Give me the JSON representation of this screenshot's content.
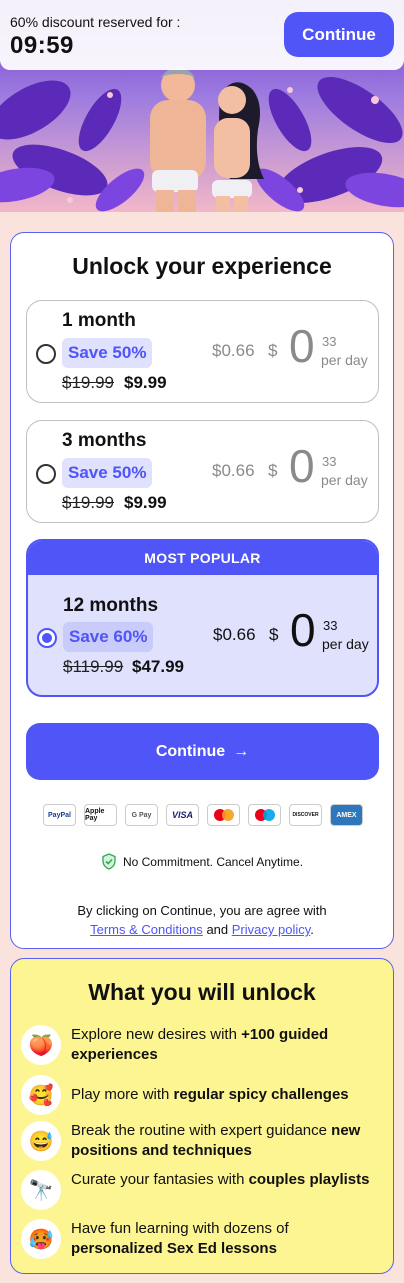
{
  "header": {
    "discount_text": "60% discount reserved for :",
    "timer": "09:59",
    "continue_label": "Continue"
  },
  "plans": {
    "title": "Unlock your experience",
    "options": [
      {
        "name": "1 month",
        "save": "Save 50%",
        "old_price": "$19.99",
        "new_price": "$9.99",
        "per_day_price": "$0.66",
        "currency": "$",
        "big_zero": "0",
        "cents": "33",
        "per_day": "per day",
        "selected": false
      },
      {
        "name": "3 months",
        "save": "Save 50%",
        "old_price": "$19.99",
        "new_price": "$9.99",
        "per_day_price": "$0.66",
        "currency": "$",
        "big_zero": "0",
        "cents": "33",
        "per_day": "per day",
        "selected": false
      },
      {
        "banner": "MOST POPULAR",
        "name": "12 months",
        "save": "Save 60%",
        "old_price": "$119.99",
        "new_price": "$47.99",
        "per_day_price": "$0.66",
        "currency": "$",
        "big_zero": "0",
        "cents": "33",
        "per_day": "per day",
        "selected": true
      }
    ],
    "continue_label": "Continue",
    "continue_arrow": "→",
    "payment_methods": [
      "PayPal",
      "Apple Pay",
      "G Pay",
      "VISA",
      "Mastercard",
      "Maestro",
      "DISCOVER",
      "AMEX"
    ],
    "commitment": "No Commitment. Cancel Anytime.",
    "terms_prefix": "By clicking on Continue, you are agree with",
    "terms_link": "Terms & Conditions",
    "terms_and": "and",
    "privacy_link": "Privacy policy",
    "terms_end": "."
  },
  "unlock": {
    "title": "What you will unlock",
    "features": [
      {
        "icon": "peach-icon",
        "glyph": "🍑",
        "text": "Explore new desires with ",
        "bold": "+100 guided experiences"
      },
      {
        "icon": "smiling-face-hearts-icon",
        "glyph": "🥰",
        "text": "Play more with ",
        "bold": "regular spicy challenges"
      },
      {
        "icon": "sweat-smile-icon",
        "glyph": "😅",
        "text": "Break the routine with expert guidance ",
        "bold": "new positions and techniques"
      },
      {
        "icon": "telescope-icon",
        "glyph": "🔭",
        "text": "Curate your fantasies with ",
        "bold": "couples playlists"
      },
      {
        "icon": "hot-face-icon",
        "glyph": "🥵",
        "text": "Have fun learning with dozens of ",
        "bold": "personalized Sex Ed lessons"
      }
    ]
  },
  "colors": {
    "accent": "#4f55f6",
    "accent_light": "#dfe1fd",
    "page_bg": "#f9e3dc",
    "unlock_bg": "#fdf591"
  }
}
